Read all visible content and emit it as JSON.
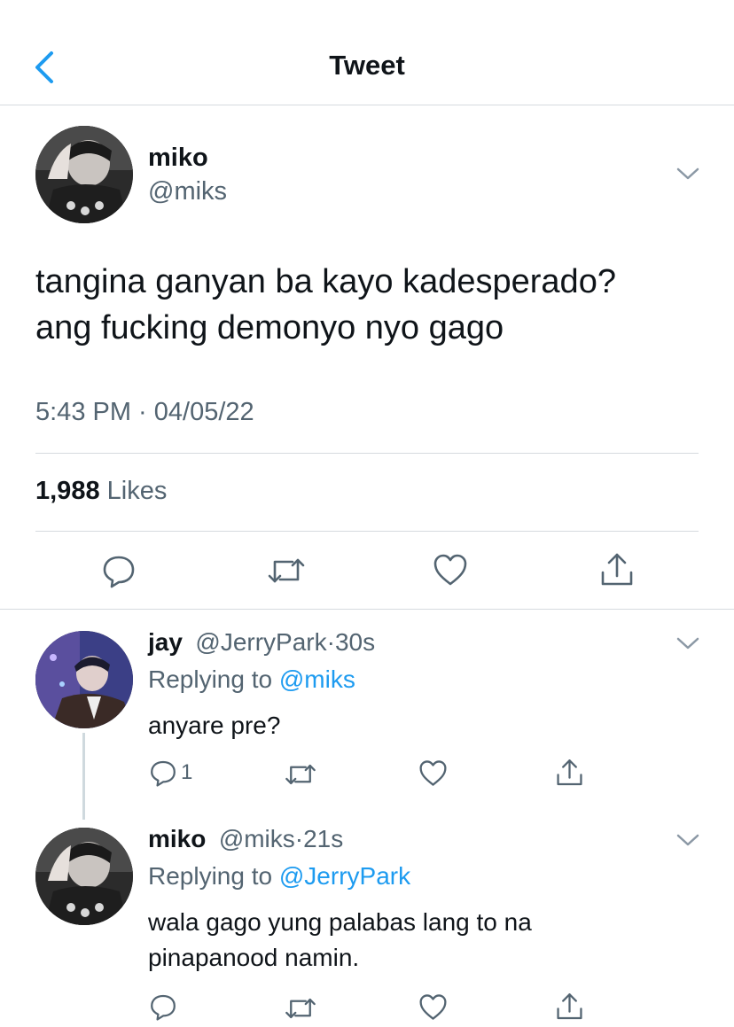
{
  "header": {
    "title": "Tweet",
    "back_icon": "chevron-left-icon"
  },
  "main_tweet": {
    "author_name": "miko",
    "author_handle": "@miks",
    "text_line1": "tangina ganyan ba kayo kadesperado?",
    "text_line2": "ang fucking demonyo nyo gago",
    "timestamp": "5:43 PM · 04/05/22",
    "likes_count": "1,988",
    "likes_label": "Likes",
    "actions": [
      "reply-icon",
      "retweet-icon",
      "like-icon",
      "share-icon"
    ]
  },
  "replies": [
    {
      "author_name": "jay",
      "author_handle": "@JerryPark",
      "time": "30s",
      "replying_prefix": "Replying to",
      "replying_to": "@miks",
      "text_line1": "anyare pre?",
      "text_line2": "",
      "reply_count": "1"
    },
    {
      "author_name": "miko",
      "author_handle": "@miks",
      "time": "21s",
      "replying_prefix": "Replying to",
      "replying_to": "@JerryPark",
      "text_line1": "wala gago yung palabas lang to na",
      "text_line2": "pinapanood namin.",
      "reply_count": ""
    }
  ],
  "colors": {
    "accent": "#1d9bf0",
    "secondary_text": "#536471",
    "divider": "#d6dbdf"
  }
}
